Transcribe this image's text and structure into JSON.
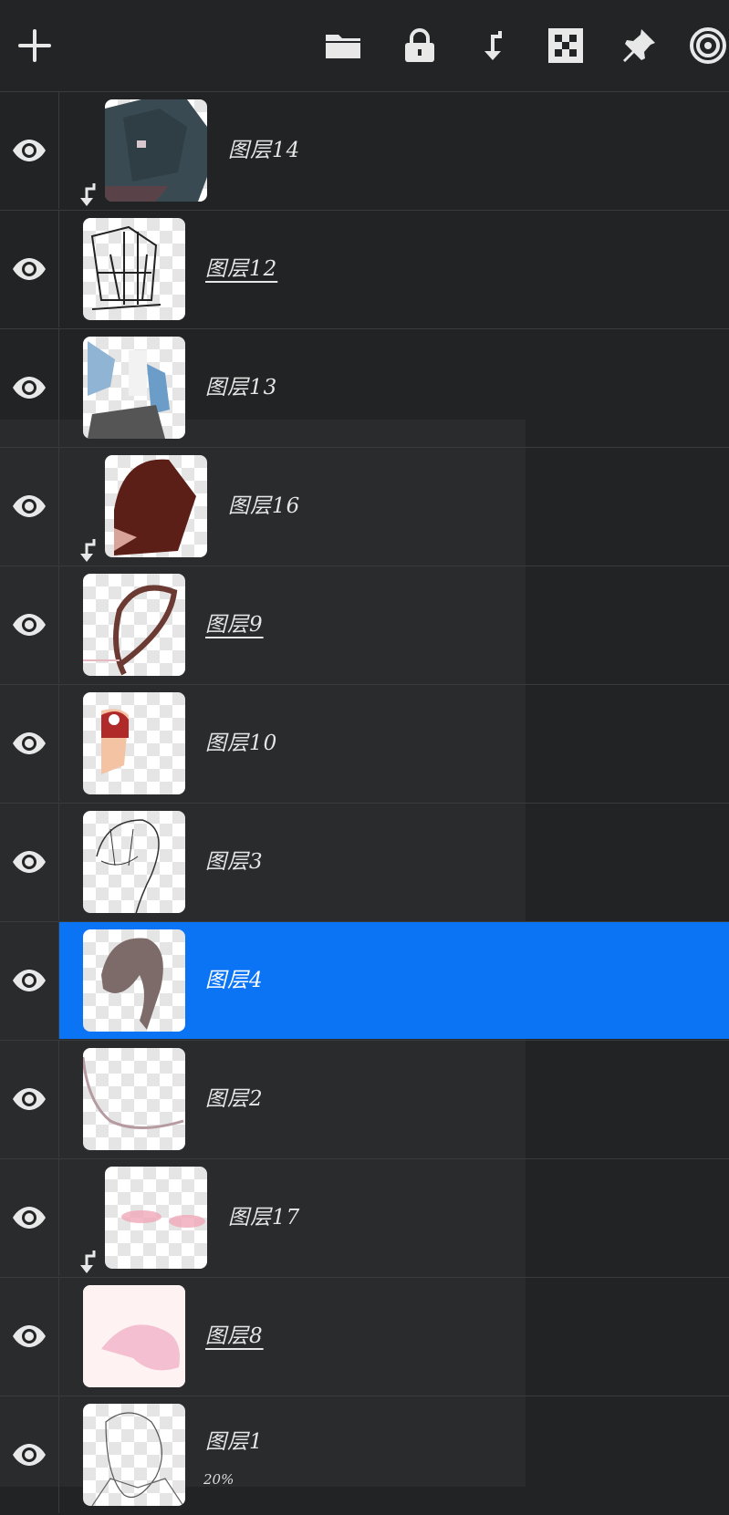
{
  "toolbar": {
    "buttons": [
      {
        "icon": "plus-icon"
      },
      {
        "icon": "folder-icon"
      },
      {
        "icon": "lock-icon"
      },
      {
        "icon": "clip-arrow-icon"
      },
      {
        "icon": "checker-icon"
      },
      {
        "icon": "pin-icon"
      },
      {
        "icon": "spiral-icon"
      }
    ]
  },
  "colors": {
    "background": "#222324",
    "selected": "#0a74f5",
    "text": "#e6e6e6"
  },
  "layers": [
    {
      "name": "图层14",
      "clipped": true,
      "underline": false,
      "selected": false,
      "visible": true
    },
    {
      "name": "图层12",
      "clipped": false,
      "underline": true,
      "selected": false,
      "visible": true
    },
    {
      "name": "图层13",
      "clipped": false,
      "underline": false,
      "selected": false,
      "visible": true
    },
    {
      "name": "图层16",
      "clipped": true,
      "underline": false,
      "selected": false,
      "visible": true
    },
    {
      "name": "图层9",
      "clipped": false,
      "underline": true,
      "selected": false,
      "visible": true
    },
    {
      "name": "图层10",
      "clipped": false,
      "underline": false,
      "selected": false,
      "visible": true
    },
    {
      "name": "图层3",
      "clipped": false,
      "underline": false,
      "selected": false,
      "visible": true
    },
    {
      "name": "图层4",
      "clipped": false,
      "underline": false,
      "selected": true,
      "visible": true
    },
    {
      "name": "图层2",
      "clipped": false,
      "underline": false,
      "selected": false,
      "visible": true
    },
    {
      "name": "图层17",
      "clipped": true,
      "underline": false,
      "selected": false,
      "visible": true
    },
    {
      "name": "图层8",
      "clipped": false,
      "underline": true,
      "selected": false,
      "visible": true
    },
    {
      "name": "图层1",
      "clipped": false,
      "underline": false,
      "selected": false,
      "visible": true,
      "opacity": "20%"
    }
  ]
}
